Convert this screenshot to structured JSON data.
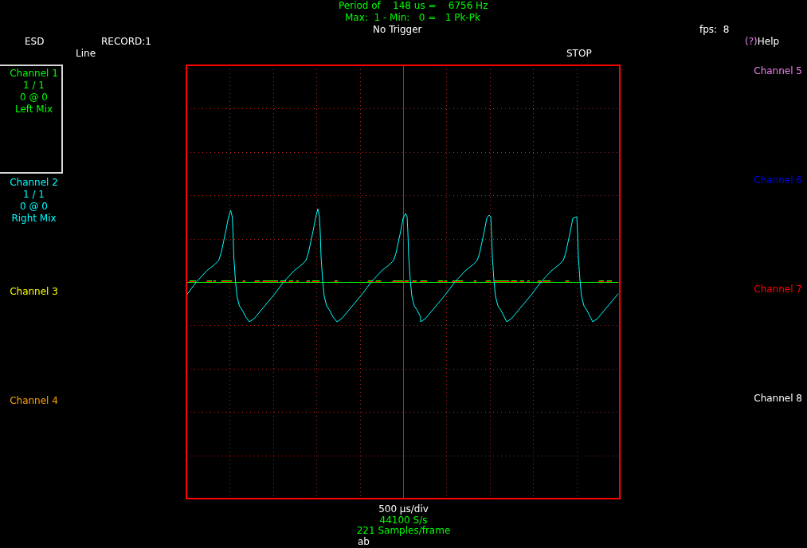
{
  "header": {
    "period": "Period of    148 us =    6756 Hz",
    "amplitude": "Max:  1 - Min:   0 =   1 Pk-Pk",
    "trigger": "No Trigger",
    "fps": "fps:  8",
    "source": "ESD",
    "record": "RECORD:1",
    "help": {
      "key": "(?)",
      "label": "Help"
    },
    "plot_mode": "Line",
    "run_state": "STOP"
  },
  "channels": [
    {
      "name": "Channel 1",
      "color": "#00ff00",
      "selected": true,
      "scale": "1 / 1",
      "position": "0 @ 0",
      "signal": "Left Mix",
      "trace": {
        "kind": "flat"
      }
    },
    {
      "name": "Channel 2",
      "color": "#00ffff",
      "selected": false,
      "scale": "1 / 1",
      "position": "0 @ 0",
      "signal": "Right Mix",
      "trace": {
        "kind": "spike"
      }
    },
    {
      "name": "Channel 3",
      "color": "#ffff00",
      "selected": false
    },
    {
      "name": "Channel 4",
      "color": "#ffa500",
      "selected": false
    },
    {
      "name": "Channel 5",
      "color": "#ee82ee",
      "selected": false
    },
    {
      "name": "Channel 6",
      "color": "#0000ff",
      "selected": false
    },
    {
      "name": "Channel 7",
      "color": "#ff0000",
      "selected": false,
      "trace": {
        "kind": "ripple"
      }
    },
    {
      "name": "Channel 8",
      "color": "#ffffff",
      "selected": false
    }
  ],
  "footer": {
    "timebase": "500 µs/div",
    "sample_rate": "44100 S/s",
    "frame_samples": "221 Samples/frame",
    "status": "ab"
  }
}
